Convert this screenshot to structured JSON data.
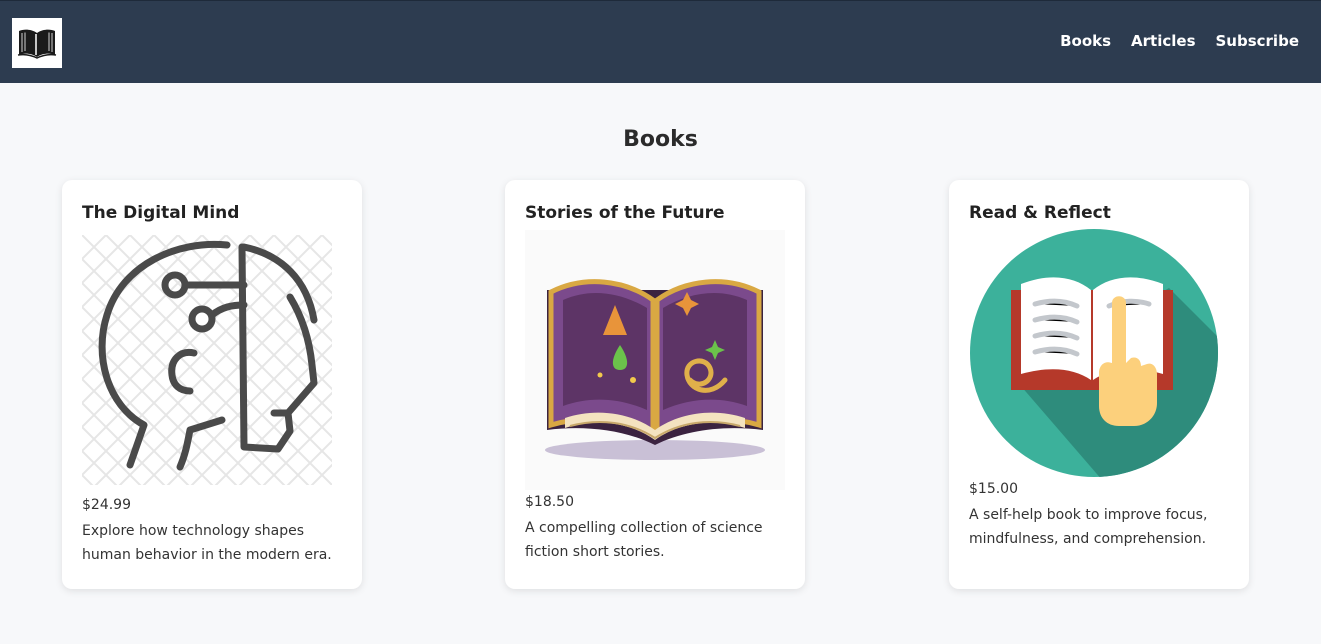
{
  "nav": {
    "logo_icon": "open-book-icon",
    "links": [
      {
        "label": "Books"
      },
      {
        "label": "Articles"
      },
      {
        "label": "Subscribe"
      }
    ]
  },
  "page": {
    "title": "Books"
  },
  "books": [
    {
      "title": "The Digital Mind",
      "price": "$24.99",
      "description": "Explore how technology shapes human behavior in the modern era.",
      "image_icon": "digital-head-icon"
    },
    {
      "title": "Stories of the Future",
      "price": "$18.50",
      "description": "A compelling collection of science fiction short stories.",
      "image_icon": "magic-book-icon"
    },
    {
      "title": "Read & Reflect",
      "price": "$15.00",
      "description": "A self-help book to improve focus, mindfulness, and comprehension.",
      "image_icon": "reading-book-icon"
    }
  ],
  "colors": {
    "navbar": "#2d3c50",
    "background": "#f7f8fa",
    "teal": "#3cb19b",
    "teal_shadow": "#2e8c7c",
    "book_red": "#b5392a",
    "hand": "#fcd07c"
  }
}
